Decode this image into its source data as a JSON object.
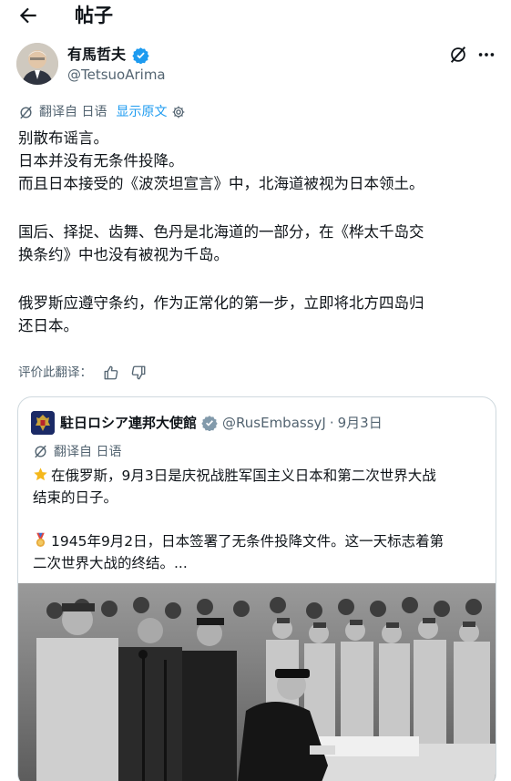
{
  "header": {
    "title": "帖子"
  },
  "author": {
    "display_name": "有馬哲夫",
    "handle": "@TetsuoArima"
  },
  "translation": {
    "label": "翻译自 日语",
    "show_original": "显示原文"
  },
  "post": {
    "paragraphs": [
      [
        "别散布谣言。",
        "日本并没有无条件投降。",
        "而且日本接受的《波茨坦宣言》中，北海道被视为日本领土。"
      ],
      [
        "国后、择捉、齿舞、色丹是北海道的一部分，在《桦太千岛交",
        "换条约》中也没有被视为千岛。"
      ],
      [
        "俄罗斯应遵守条约，作为正常化的第一步，立即将北方四岛归",
        "还日本。"
      ]
    ]
  },
  "rate": {
    "label": "评价此翻译："
  },
  "quote": {
    "account_name": "駐日ロシア連邦大使館",
    "handle": "@RusEmbassyJ",
    "separator": "·",
    "date": "9月3日",
    "translation_label": "翻译自 日语",
    "line1a": "在俄罗斯，9月3日是庆祝战胜军国主义日本和第二次世界大战",
    "line1b": "结束的日子。",
    "line2a": "1945年9月2日，日本签署了无条件投降文件。这一天标志着第",
    "line2b": "二次世界大战的终结。..."
  },
  "colors": {
    "text": "#0f1419",
    "secondary": "#536471",
    "link": "#1d9bf0",
    "border": "#cfd9de"
  },
  "icons": [
    "back-arrow-icon",
    "verified-badge-icon",
    "grok-icon",
    "more-icon",
    "translate-icon",
    "gear-icon",
    "thumbs-up-icon",
    "thumbs-down-icon",
    "star-emoji-icon",
    "medal-emoji-icon"
  ]
}
